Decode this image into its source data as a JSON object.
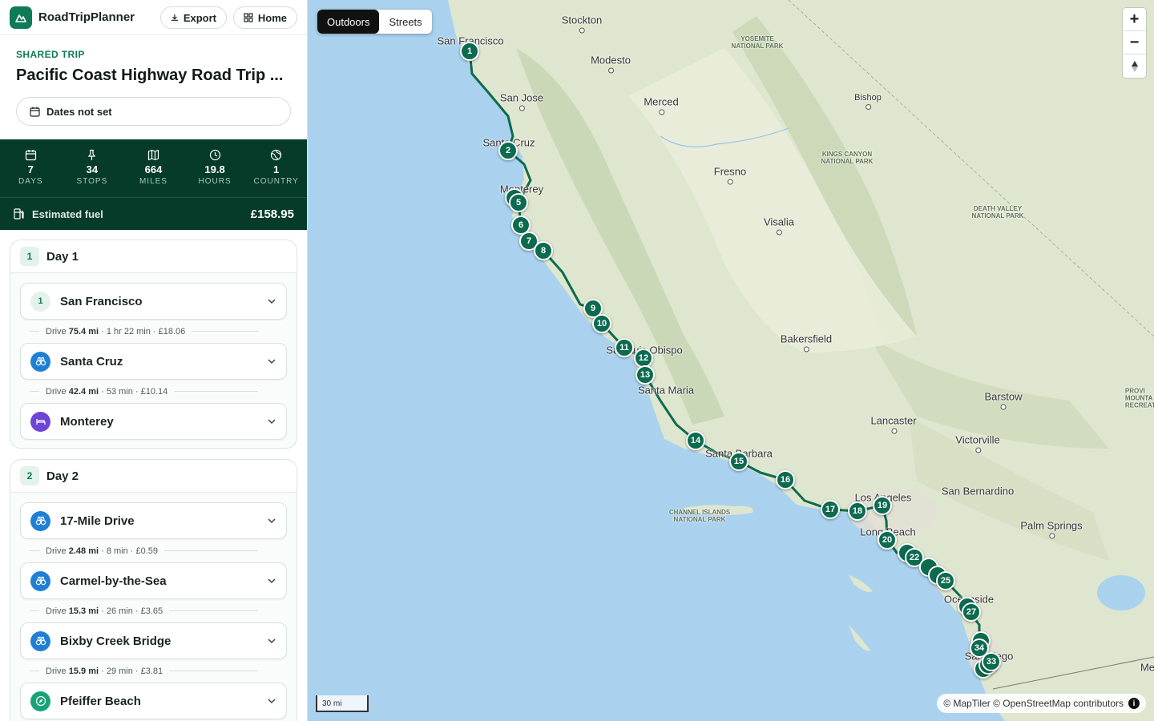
{
  "app": {
    "name": "RoadTripPlanner",
    "export_label": "Export",
    "home_label": "Home"
  },
  "trip": {
    "shared_label": "SHARED TRIP",
    "title": "Pacific Coast Highway Road Trip ...",
    "dates_label": "Dates not set"
  },
  "stats": {
    "days": {
      "value": "7",
      "label": "DAYS"
    },
    "stops": {
      "value": "34",
      "label": "STOPS"
    },
    "miles": {
      "value": "664",
      "label": "MILES"
    },
    "hours": {
      "value": "19.8",
      "label": "HOURS"
    },
    "country": {
      "value": "1",
      "label": "COUNTRY"
    },
    "fuel_label": "Estimated fuel",
    "fuel_value": "£158.95"
  },
  "day1": {
    "num": "1",
    "title": "Day 1",
    "stops": [
      {
        "badge": "1",
        "name": "San Francisco",
        "icon": "number"
      },
      {
        "name": "Santa Cruz",
        "icon": "binoculars"
      },
      {
        "name": "Monterey",
        "icon": "bed"
      }
    ],
    "drives": [
      {
        "prefix": "Drive",
        "dist": "75.4 mi",
        "rest": "· 1 hr 22 min · £18.06"
      },
      {
        "prefix": "Drive",
        "dist": "42.4 mi",
        "rest": "· 53 min · £10.14"
      }
    ]
  },
  "day2": {
    "num": "2",
    "title": "Day 2",
    "stops": [
      {
        "name": "17-Mile Drive",
        "icon": "binoculars"
      },
      {
        "name": "Carmel-by-the-Sea",
        "icon": "binoculars"
      },
      {
        "name": "Bixby Creek Bridge",
        "icon": "binoculars"
      },
      {
        "name": "Pfeiffer Beach",
        "icon": "compass"
      }
    ],
    "drives": [
      {
        "prefix": "Drive",
        "dist": "2.48 mi",
        "rest": "· 8 min · £0.59"
      },
      {
        "prefix": "Drive",
        "dist": "15.3 mi",
        "rest": "· 26 min · £3.65"
      },
      {
        "prefix": "Drive",
        "dist": "15.9 mi",
        "rest": "· 29 min · £3.81"
      }
    ]
  },
  "map": {
    "style_outdoors": "Outdoors",
    "style_streets": "Streets",
    "zoom_in": "+",
    "zoom_out": "−",
    "scale_label": "30 mi",
    "attribution": "© MapTiler © OpenStreetMap contributors",
    "route_color": "#0c6b4f",
    "labels": [
      "San Francisco",
      "Stockton",
      "Modesto",
      "Merced",
      "San Jose",
      "Santa Cruz",
      "Monterey",
      "Fresno",
      "Visalia",
      "Bishop",
      "San Luis Obispo",
      "Santa Maria",
      "Bakersfield",
      "Santa Barbara",
      "Lancaster",
      "Victorville",
      "Barstow",
      "Los Angeles",
      "San Bernardino",
      "Long Beach",
      "Palm Springs",
      "Oceanside",
      "San Diego",
      "Me"
    ],
    "parks": [
      "YOSEMITE\nNATIONAL PARK",
      "KINGS CANYON\nNATIONAL PARK",
      "DEATH VALLEY\nNATIONAL PARK",
      "CHANNEL ISLANDS\nNATIONAL PARK",
      "PROVI\nMOUNTA\nRECREATI"
    ],
    "markers": [
      "1",
      "2",
      "5",
      "6",
      "7",
      "8",
      "9",
      "10",
      "11",
      "12",
      "13",
      "14",
      "15",
      "16",
      "17",
      "18",
      "19",
      "20",
      "22",
      "25",
      "27",
      "34",
      "33"
    ]
  }
}
